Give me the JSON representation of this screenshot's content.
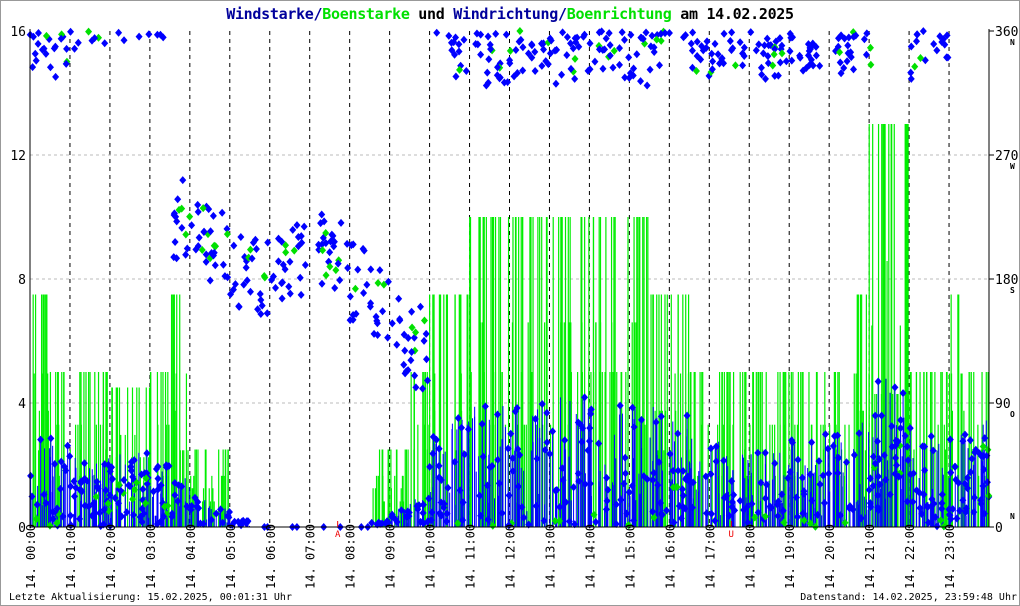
{
  "chart_data": {
    "type": "scatter",
    "title": {
      "part1": "Windstarke/",
      "part2": "Boenstarke",
      "part3": " und ",
      "part4": "Windrichtung/",
      "part5": "Boenrichtung",
      "part6": " am 14.02.2025"
    },
    "date_label": "14.",
    "x_ticks": [
      "00:00",
      "01:00",
      "02:00",
      "03:00",
      "04:00",
      "05:00",
      "06:00",
      "07:00",
      "08:00",
      "09:00",
      "10:00",
      "11:00",
      "12:00",
      "13:00",
      "14:00",
      "15:00",
      "16:00",
      "17:00",
      "18:00",
      "19:00",
      "20:00",
      "21:00",
      "22:00",
      "23:00"
    ],
    "y_left": {
      "ticks": [
        "0",
        "4",
        "8",
        "12",
        "16"
      ],
      "range": [
        0,
        16
      ]
    },
    "y_right": {
      "ticks": [
        "0",
        "90",
        "180",
        "270",
        "360"
      ],
      "letters": [
        "N",
        "O",
        "S",
        "W",
        "N"
      ],
      "range": [
        0,
        360
      ]
    },
    "grid": true,
    "markers": [
      {
        "label": "A",
        "hour": 7.7
      },
      {
        "label": "U",
        "hour": 17.55
      }
    ],
    "interval_hours": 0.5,
    "series": [
      {
        "name": "Windstarke",
        "color": "#0000ff",
        "values": [
          1.5,
          1.5,
          1.2,
          1.2,
          1.2,
          1.2,
          1.0,
          0.8,
          0.5,
          0.3,
          0.1,
          0,
          0,
          0,
          0,
          0,
          0,
          0.1,
          0.3,
          0.5,
          1.5,
          1.8,
          2,
          2,
          2,
          2,
          2.2,
          2.2,
          2,
          2,
          2,
          2,
          1.8,
          1.5,
          1.5,
          1.5,
          1.2,
          1.2,
          1.5,
          1.5,
          1.5,
          1.8,
          2.5,
          2.5,
          1.8,
          1.5,
          1.5,
          1.8
        ]
      },
      {
        "name": "Boenstarke",
        "color": "#00ff00",
        "values": [
          7.5,
          5,
          5,
          5,
          4.5,
          4.5,
          5,
          7.5,
          2.5,
          2.5,
          0,
          0,
          0,
          0,
          0,
          0,
          0,
          2.5,
          2.5,
          5,
          7.5,
          7.5,
          10,
          10,
          10,
          10,
          10,
          10,
          10,
          10,
          10,
          7.5,
          7.5,
          5,
          5,
          5,
          5,
          5,
          5,
          5,
          5,
          7.5,
          13,
          13,
          5,
          5,
          7.5,
          5
        ]
      },
      {
        "name": "Windrichtung",
        "color": "#0000ff",
        "values": [
          355,
          350,
          10,
          10,
          15,
          20,
          20,
          225,
          215,
          200,
          185,
          180,
          190,
          195,
          200,
          195,
          180,
          165,
          140,
          130,
          20,
          350,
          345,
          345,
          350,
          350,
          345,
          350,
          350,
          350,
          345,
          350,
          20,
          350,
          355,
          355,
          350,
          350,
          355,
          355,
          350,
          355,
          30,
          40,
          350,
          355,
          20,
          40
        ]
      },
      {
        "name": "Boenrichtung",
        "color": "#00ff00",
        "values": [
          355,
          350,
          10,
          10,
          15,
          20,
          20,
          225,
          215,
          200,
          185,
          180,
          190,
          195,
          200,
          195,
          180,
          165,
          140,
          130,
          20,
          350,
          345,
          345,
          350,
          350,
          345,
          350,
          350,
          350,
          345,
          350,
          20,
          350,
          355,
          355,
          350,
          350,
          355,
          355,
          350,
          355,
          30,
          40,
          350,
          355,
          20,
          40
        ]
      }
    ]
  },
  "footer": {
    "left": "Letzte Aktualisierung: 15.02.2025, 00:01:31 Uhr",
    "right": "Datenstand: 14.02.2025, 23:59:48 Uhr"
  }
}
